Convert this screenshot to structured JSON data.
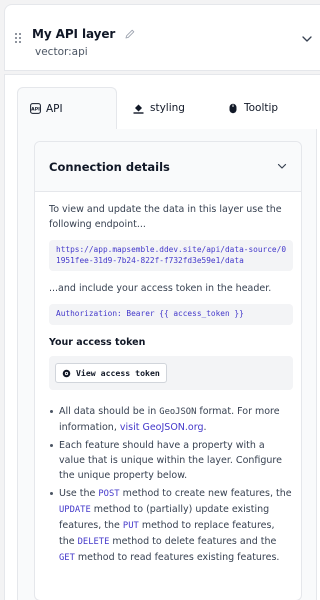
{
  "layer": {
    "title": "My API layer",
    "subtitle": "vector:api"
  },
  "tabs": [
    {
      "label": "API",
      "icon": "api-icon",
      "active": true
    },
    {
      "label": "styling",
      "icon": "paint-bucket-icon"
    },
    {
      "label": "Tooltip",
      "icon": "mouse-icon"
    }
  ],
  "connection": {
    "title": "Connection details",
    "intro": "To view and update the data in this layer use the following endpoint...",
    "endpoint": "https://app.mapsemble.ddev.site/api/data-source/01951fee-31d9-7b24-822f-f732fd3e59e1/data",
    "header_text": "...and include your access token in the header.",
    "auth_header": "Authorization: Bearer {{ access_token }}",
    "token_heading": "Your access token",
    "token_button": "View access token",
    "bullets": {
      "b1_a": "All data should be in ",
      "b1_code": "GeoJSON",
      "b1_b": " format. For more information, ",
      "b1_link": "visit GeoJSON.org",
      "b1_c": ".",
      "b2": "Each feature should have a property with a value that is unique within the layer. Configure the unique property below.",
      "b3_a": "Use the ",
      "b3_post": "POST",
      "b3_b": " method to create new features, the ",
      "b3_update": "UPDATE",
      "b3_c": " method to (partially) update existing features, the ",
      "b3_put": "PUT",
      "b3_d": " method to replace features, the ",
      "b3_delete": "DELETE",
      "b3_e": " method to delete features and the ",
      "b3_get": "GET",
      "b3_f": " method to read features existing features."
    }
  },
  "colors": {
    "accent": "#4338ca",
    "border": "#e5e7eb",
    "code_bg": "#f3f4f6"
  }
}
